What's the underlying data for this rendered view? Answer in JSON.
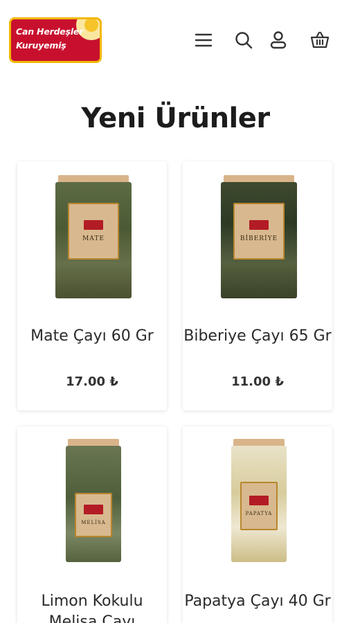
{
  "header": {
    "logo_line1": "Can Herdeşler",
    "logo_line2": "Kuruyemiş",
    "icons": [
      "menu-icon",
      "search-icon",
      "user-icon",
      "basket-icon"
    ]
  },
  "section": {
    "title": "Yeni Ürünler"
  },
  "products": [
    {
      "name": "Mate Çayı 60 Gr",
      "price": "17.00 ₺",
      "package_label": "MATE"
    },
    {
      "name": "Biberiye Çayı 65 Gr",
      "price": "11.00 ₺",
      "package_label": "BİBERİYE"
    },
    {
      "name": "Limon Kokulu Melisa Çayı",
      "price": "",
      "package_label": "MELİSA"
    },
    {
      "name": "Papatya Çayı 40 Gr",
      "price": "",
      "package_label": "PAPATYA"
    }
  ],
  "colors": {
    "brand_red": "#c8102e",
    "brand_gold": "#f2b705",
    "text": "#222222"
  }
}
